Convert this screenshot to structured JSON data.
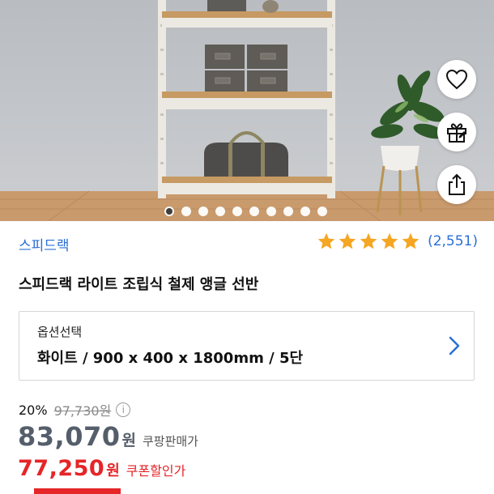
{
  "product_image": {
    "slide_count": 10,
    "active_slide": 1
  },
  "actions": {
    "favorite_icon": "heart-icon",
    "gift_icon": "gift-icon",
    "share_icon": "share-icon"
  },
  "brand": "스피드랙",
  "rating": {
    "stars": 5,
    "review_count": "(2,551)"
  },
  "title": "스피드랙 라이트 조립식 철제 앵글 선반",
  "option": {
    "label": "옵션선택",
    "value": "화이트 / 900 x 400 x 1800mm / 5단"
  },
  "pricing": {
    "discount_rate": "20%",
    "original_price": "97,730원",
    "info_icon": "info-icon",
    "price": "83,070",
    "currency": "원",
    "price_label": "쿠팡판매가",
    "coupon_price": "77,250",
    "coupon_currency": "원",
    "coupon_label": "쿠폰할인가"
  },
  "colors": {
    "brand_blue": "#2a6fd6",
    "star_gold": "#f5a623",
    "coupon_red": "#e52528",
    "price_gray": "#555e6b"
  }
}
